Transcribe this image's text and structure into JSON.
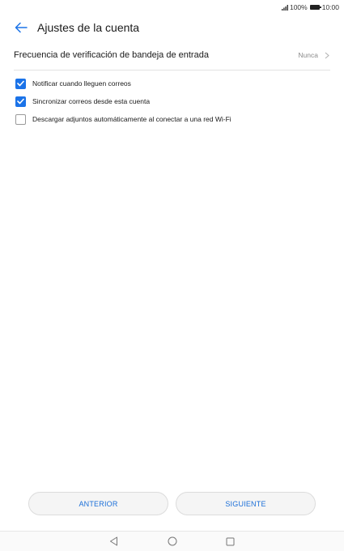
{
  "status_bar": {
    "battery_text": "100%",
    "time": "10:00"
  },
  "header": {
    "title": "Ajustes de la cuenta",
    "back_icon": "arrow-left-icon"
  },
  "settings": {
    "frequency": {
      "label": "Frecuencia de verificación de bandeja de entrada",
      "value": "Nunca"
    },
    "options": [
      {
        "label": "Notificar cuando lleguen correos",
        "checked": true
      },
      {
        "label": "Sincronizar correos desde esta cuenta",
        "checked": true
      },
      {
        "label": "Descargar adjuntos automáticamente al conectar a una red Wi-Fi",
        "checked": false
      }
    ]
  },
  "buttons": {
    "previous": "ANTERIOR",
    "next": "SIGUIENTE"
  },
  "nav": {
    "back_icon": "triangle-back-icon",
    "home_icon": "circle-home-icon",
    "recents_icon": "square-recents-icon"
  },
  "colors": {
    "accent": "#1b73e8",
    "button_text": "#1b6fd8"
  }
}
